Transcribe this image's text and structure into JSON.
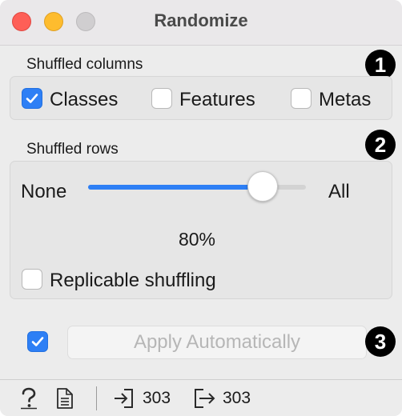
{
  "window": {
    "title": "Randomize"
  },
  "shuffled_columns": {
    "label": "Shuffled columns",
    "badge": "1",
    "options": [
      {
        "label": "Classes",
        "checked": true
      },
      {
        "label": "Features",
        "checked": false
      },
      {
        "label": "Metas",
        "checked": false
      }
    ]
  },
  "shuffled_rows": {
    "label": "Shuffled rows",
    "badge": "2",
    "slider": {
      "min_label": "None",
      "max_label": "All",
      "value_percent": 80,
      "value_text": "80%"
    },
    "replicable": {
      "label": "Replicable shuffling",
      "checked": false
    }
  },
  "apply": {
    "auto_checked": true,
    "button_label": "Apply Automatically",
    "badge": "3"
  },
  "statusbar": {
    "input_count": "303",
    "output_count": "303"
  },
  "colors": {
    "accent": "#2d7ff5",
    "close": "#fe5f57",
    "minimize": "#febc2e"
  }
}
